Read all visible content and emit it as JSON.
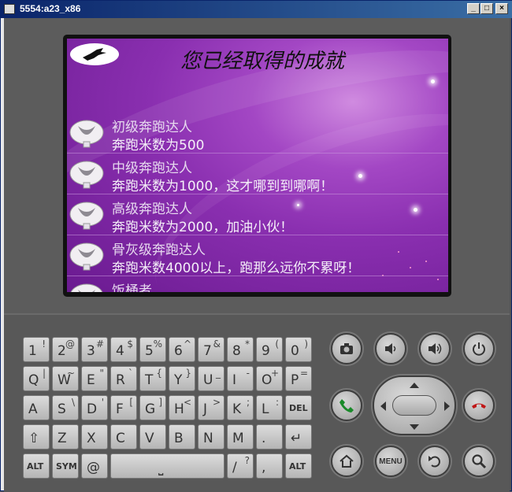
{
  "window": {
    "title": "5554:a23_x86",
    "min": "_",
    "max": "□",
    "close": "×"
  },
  "screen": {
    "title": "您已经取得的成就",
    "achievements": [
      {
        "name": "初级奔跑达人",
        "desc": "奔跑米数为500"
      },
      {
        "name": "中级奔跑达人",
        "desc": "奔跑米数为1000，这才哪到到哪啊！"
      },
      {
        "name": "高级奔跑达人",
        "desc": "奔跑米数为2000，加油小伙！"
      },
      {
        "name": "骨灰级奔跑达人",
        "desc": "奔跑米数4000以上，跑那么远你不累呀！"
      },
      {
        "name": "饭桶者",
        "desc": ""
      }
    ]
  },
  "keyboard": {
    "row1": [
      {
        "main": "1",
        "alt": "!"
      },
      {
        "main": "2",
        "alt": "@"
      },
      {
        "main": "3",
        "alt": "#"
      },
      {
        "main": "4",
        "alt": "$"
      },
      {
        "main": "5",
        "alt": "%"
      },
      {
        "main": "6",
        "alt": "^"
      },
      {
        "main": "7",
        "alt": "&"
      },
      {
        "main": "8",
        "alt": "*"
      },
      {
        "main": "9",
        "alt": "("
      },
      {
        "main": "0",
        "alt": ")"
      }
    ],
    "row2": [
      {
        "main": "Q",
        "alt": "|"
      },
      {
        "main": "W",
        "alt": "~"
      },
      {
        "main": "E",
        "alt": "\""
      },
      {
        "main": "R",
        "alt": "`"
      },
      {
        "main": "T",
        "alt": "{"
      },
      {
        "main": "Y",
        "alt": "}"
      },
      {
        "main": "U",
        "alt": "_"
      },
      {
        "main": "I",
        "alt": "-"
      },
      {
        "main": "O",
        "alt": "+"
      },
      {
        "main": "P",
        "alt": "="
      }
    ],
    "row3": [
      {
        "main": "A",
        "alt": ""
      },
      {
        "main": "S",
        "alt": "\\"
      },
      {
        "main": "D",
        "alt": "'"
      },
      {
        "main": "F",
        "alt": "["
      },
      {
        "main": "G",
        "alt": "]"
      },
      {
        "main": "H",
        "alt": "<"
      },
      {
        "main": "J",
        "alt": ">"
      },
      {
        "main": "K",
        "alt": ";"
      },
      {
        "main": "L",
        "alt": ":"
      },
      {
        "main": "DEL",
        "alt": ""
      }
    ],
    "row4": [
      {
        "main": "⇧",
        "alt": ""
      },
      {
        "main": "Z",
        "alt": ""
      },
      {
        "main": "X",
        "alt": ""
      },
      {
        "main": "C",
        "alt": ""
      },
      {
        "main": "V",
        "alt": ""
      },
      {
        "main": "B",
        "alt": ""
      },
      {
        "main": "N",
        "alt": ""
      },
      {
        "main": "M",
        "alt": ""
      },
      {
        "main": ".",
        "alt": ""
      },
      {
        "main": "↵",
        "alt": ""
      }
    ],
    "row5": {
      "alt_left": "ALT",
      "sym": "SYM",
      "at": "@",
      "space": "⎵",
      "slash": "/",
      "slash_alt": "?",
      "comma": ",",
      "alt_right": "ALT"
    }
  },
  "hardware": {
    "menu_label": "MENU"
  }
}
